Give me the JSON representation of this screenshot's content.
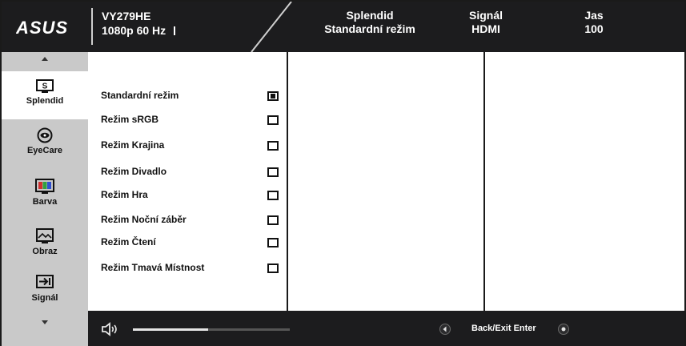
{
  "header": {
    "logo_text": "ASUS",
    "model": "VY279HE",
    "resolution": "1080p 60 Hz",
    "info": [
      {
        "title": "Splendid",
        "value": "Standardní režim"
      },
      {
        "title": "Signál",
        "value": "HDMI"
      },
      {
        "title": "Jas",
        "value": "100"
      }
    ]
  },
  "sidebar": {
    "items": [
      {
        "label": "Splendid",
        "icon": "splendid-icon",
        "active": true
      },
      {
        "label": "EyeCare",
        "icon": "eyecare-icon",
        "active": false
      },
      {
        "label": "Barva",
        "icon": "color-icon",
        "active": false
      },
      {
        "label": "Obraz",
        "icon": "image-icon",
        "active": false
      },
      {
        "label": "Signál",
        "icon": "input-signal-icon",
        "active": false
      }
    ]
  },
  "options": [
    {
      "label": "Standardní režim",
      "checked": true
    },
    {
      "label": "Režim sRGB",
      "checked": false
    },
    {
      "label": "Režim Krajina",
      "checked": false
    },
    {
      "label": "Režim Divadlo",
      "checked": false
    },
    {
      "label": "Režim Hra",
      "checked": false
    },
    {
      "label": "Režim Noční záběr",
      "checked": false
    },
    {
      "label": "Režim Čtení",
      "checked": false
    },
    {
      "label": "Režim Tmavá Místnost",
      "checked": false
    }
  ],
  "footer": {
    "volume_fraction": 0.48,
    "help_text": "Back/Exit Enter"
  },
  "colors": {
    "header_bg": "#1c1c1e",
    "sidebar_bg": "#c9c9c9",
    "bar_colors": [
      "#d03030",
      "#30a040",
      "#3050d0"
    ]
  }
}
